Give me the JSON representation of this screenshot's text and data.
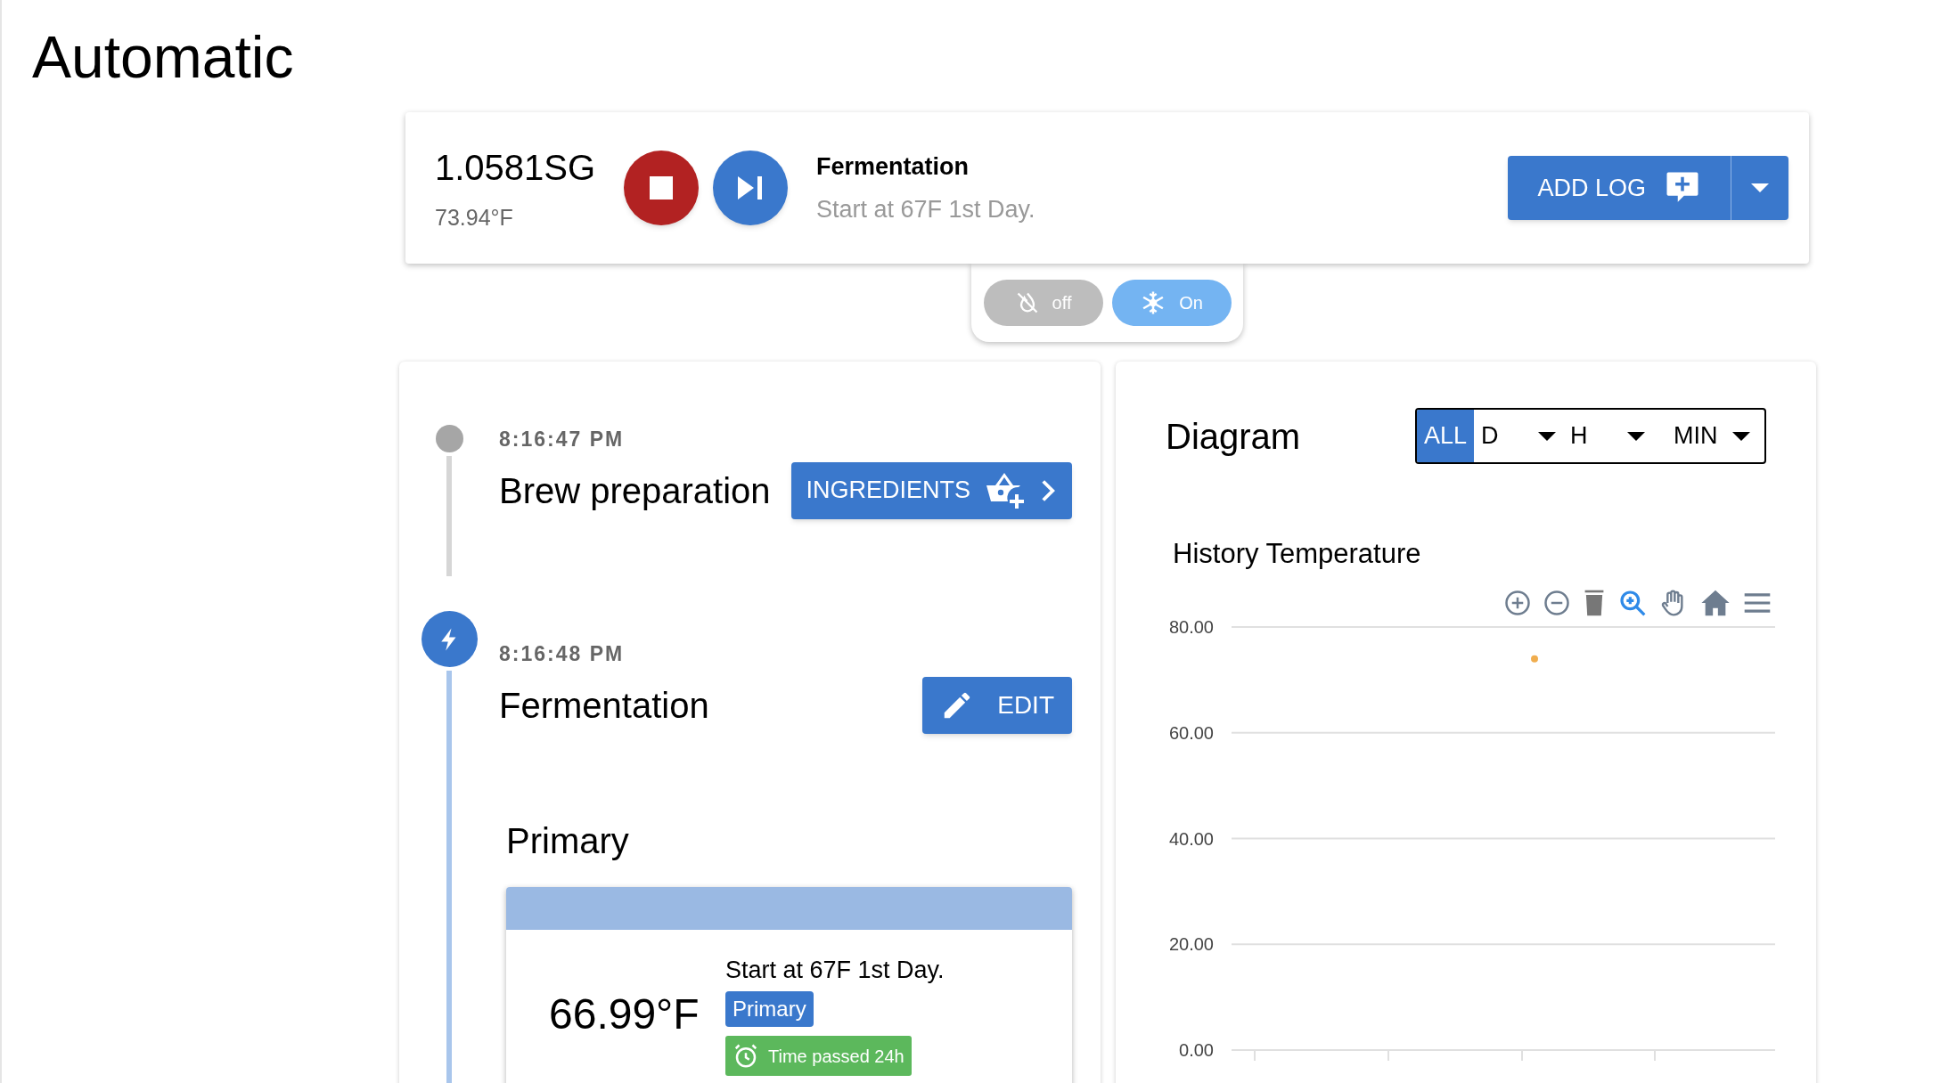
{
  "page_title": "Automatic",
  "status": {
    "gravity": "1.0581SG",
    "temperature": "73.94°F",
    "stage": "Fermentation",
    "step": "Start at 67F 1st Day.",
    "add_log": "ADD LOG"
  },
  "cooling_toggle": [
    {
      "label": "off",
      "selected": false
    },
    {
      "label": "On",
      "selected": true
    }
  ],
  "timeline": [
    {
      "kind": "done",
      "time": "8:16:47 PM",
      "title": "Brew preparation",
      "action": {
        "kind": "ingredients",
        "label": "INGREDIENTS"
      }
    },
    {
      "kind": "active",
      "time": "8:16:48 PM",
      "title": "Fermentation",
      "action": {
        "kind": "edit",
        "label": "EDIT"
      }
    }
  ],
  "phase": {
    "title": "Primary",
    "temperature": "66.99°F",
    "step": "Start at 67F 1st Day.",
    "badge": "Primary",
    "timer": "Time passed 24h"
  },
  "diagram": {
    "title": "Diagram",
    "ranges": [
      {
        "kind": "button",
        "label": "ALL",
        "selected": true
      },
      {
        "kind": "dropdown",
        "label": "D",
        "selected": false
      },
      {
        "kind": "dropdown",
        "label": "H",
        "selected": false
      },
      {
        "kind": "dropdown",
        "label": "MIN",
        "selected": false
      }
    ],
    "chart_data": {
      "type": "scatter",
      "title": "History Temperature",
      "ylim": [
        0,
        80
      ],
      "yticks": [
        {
          "value": 80,
          "label": "80.00"
        },
        {
          "value": 60,
          "label": "60.00"
        },
        {
          "value": 40,
          "label": "40.00"
        },
        {
          "value": 20,
          "label": "20.00"
        },
        {
          "value": 0,
          "label": "0.00"
        }
      ],
      "grid": true,
      "series": [
        {
          "color": "#f0ad4e",
          "values": [
            74
          ]
        }
      ]
    }
  }
}
